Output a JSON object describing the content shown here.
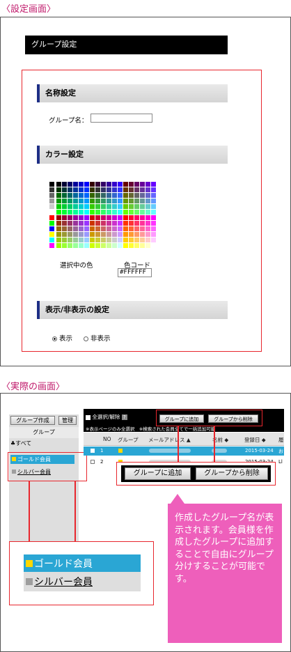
{
  "settings_heading": "〈設定画面〉",
  "actual_heading": "〈実際の画面〉",
  "settings": {
    "title_bar": "グループ設定",
    "name_section": "名称設定",
    "group_name_label": "グループ名：",
    "group_name_value": "",
    "color_section": "カラー設定",
    "selected_color_label": "選択中の色",
    "color_code_label": "色コード",
    "color_code_value": "#FFFFFF",
    "visibility_section": "表示/非表示の設定",
    "show_label": "表示",
    "hide_label": "非表示",
    "show_checked": true
  },
  "actual": {
    "sidebar": {
      "create_group_button": "グループ作成",
      "manage_button": "管理",
      "group_header": "グループ",
      "all_label": "すべて",
      "items": [
        {
          "label": "ゴールド会員",
          "color": "#ffd700",
          "selected": true
        },
        {
          "label": "シルバー会員",
          "color": "#9e9e9e",
          "selected": false
        }
      ]
    },
    "toolbar": {
      "select_all_label": "全選択/解除",
      "help_icon_label": "?",
      "add_to_group_button": "グループに追加",
      "remove_from_group_button": "グループから削除",
      "note": "※表示ページのみ全選択　※検索された会員全てで一括追加可能"
    },
    "table": {
      "columns": [
        "NO",
        "グループ",
        "メールアドレス ▲",
        "名前 ◆",
        "登録日 ◆",
        "履"
      ],
      "rows": [
        {
          "no": "1",
          "group_color": "#ffd700",
          "registered": "2015-03-24",
          "last": "お",
          "selected": true
        },
        {
          "no": "2",
          "group_color": "#ffd700",
          "registered": "2015-03-24",
          "last": "Ll",
          "selected": false
        }
      ]
    },
    "zoom_buttons": {
      "add_label": "グループに追加",
      "remove_label": "グループから削除"
    },
    "zoom_sidebar": {
      "items": [
        {
          "label": "ゴールド会員",
          "color": "#ffd700"
        },
        {
          "label": "シルバー会員",
          "color": "#9e9e9e"
        }
      ]
    },
    "callout_text": "作成したグループ名が表示されます。会員様を作成したグループに追加することで自由にグループ分けすることが可能です。"
  },
  "colors": {
    "accent_red": "#e8262d",
    "callout_pink": "#ee5fbb",
    "selected_row_blue": "#2aa6d4",
    "section_bar_navy": "#1e2f86"
  }
}
